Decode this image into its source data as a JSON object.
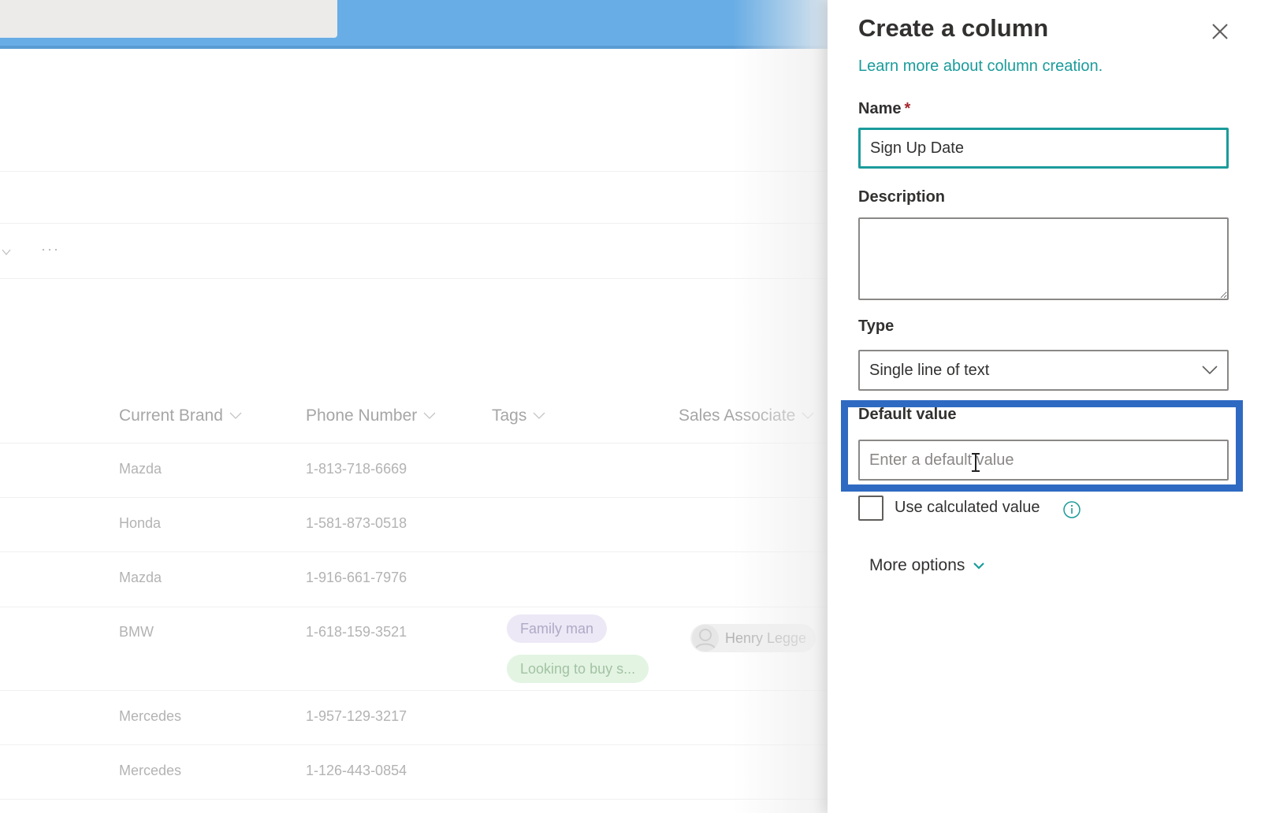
{
  "background": {
    "search_placeholder": "",
    "command_more": "···",
    "columns": [
      {
        "label": "Current Brand"
      },
      {
        "label": "Phone Number"
      },
      {
        "label": "Tags"
      },
      {
        "label": "Sales Associate"
      }
    ],
    "rows": [
      {
        "brand": "Mazda",
        "phone": "1-813-718-6669",
        "tags": [],
        "associate": ""
      },
      {
        "brand": "Honda",
        "phone": "1-581-873-0518",
        "tags": [],
        "associate": ""
      },
      {
        "brand": "Mazda",
        "phone": "1-916-661-7976",
        "tags": [],
        "associate": ""
      },
      {
        "brand": "BMW",
        "phone": "1-618-159-3521",
        "tags": [
          "Family man",
          "Looking to buy s..."
        ],
        "associate": "Henry Legge"
      },
      {
        "brand": "Mercedes",
        "phone": "1-957-129-3217",
        "tags": [],
        "associate": ""
      },
      {
        "brand": "Mercedes",
        "phone": "1-126-443-0854",
        "tags": [],
        "associate": ""
      }
    ]
  },
  "panel": {
    "title": "Create a column",
    "learn_more": "Learn more about column creation.",
    "name_label": "Name",
    "required_mark": "*",
    "name_value": "Sign Up Date",
    "description_label": "Description",
    "description_value": "",
    "type_label": "Type",
    "type_value": "Single line of text",
    "default_label": "Default value",
    "default_placeholder": "Enter a default value",
    "default_value": "",
    "calculated_label": "Use calculated value",
    "calculated_checked": false,
    "more_options": "More options"
  },
  "colors": {
    "accent": "#1b9b9b",
    "highlight": "#2f6ac2",
    "suitebar": "#68ade5"
  }
}
